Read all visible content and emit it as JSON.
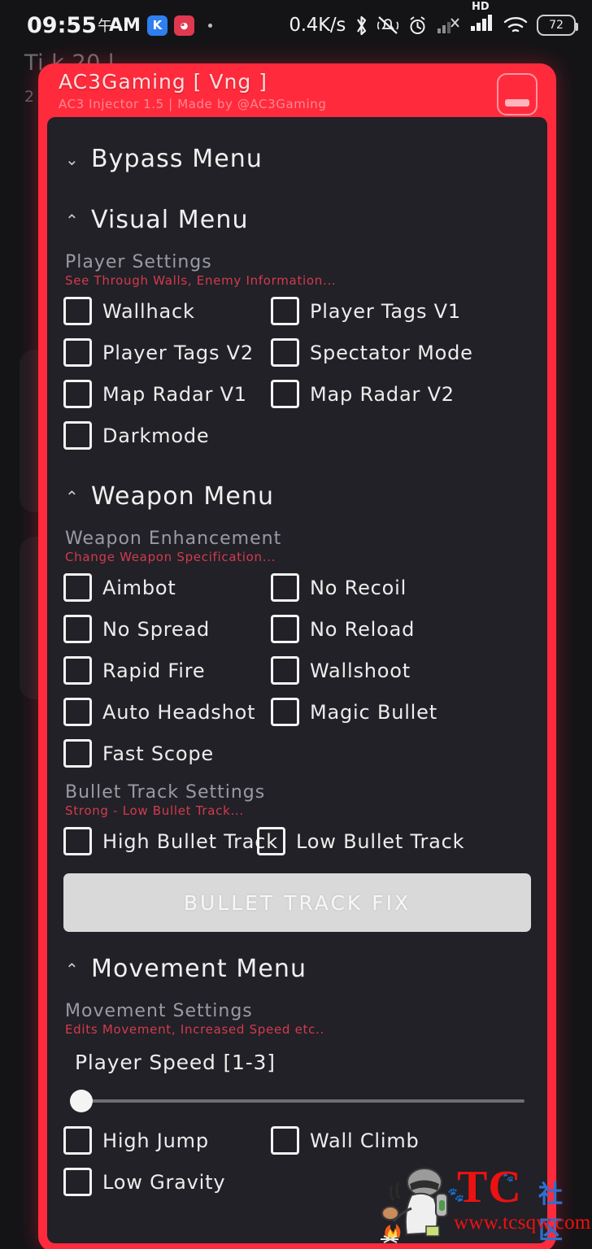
{
  "statusbar": {
    "time": "09:55",
    "ampm": "AM",
    "cjk_marker": "午",
    "app_icons": [
      {
        "name": "kuaishou-app-icon",
        "glyph": "K",
        "color": "#2e7ff0"
      },
      {
        "name": "chat-app-icon",
        "glyph": "●",
        "color": "#e0394f"
      }
    ],
    "network_speed": "0.4K/s",
    "icons": [
      "bluetooth-icon",
      "vibrate-off-icon",
      "alarm-icon",
      "no-sim-signal-icon",
      "hd-label",
      "signal-bars-icon",
      "wifi-icon"
    ],
    "hd_label": "HD",
    "battery_percent": "72"
  },
  "background": {
    "title_fragment": "Ti        k   20 l",
    "line2_fragment": "2"
  },
  "panel": {
    "title": "AC3Gaming [ Vng ]",
    "subtitle": "AC3 Injector 1.5 | Made by @AC3Gaming",
    "minimize_label": "minimize",
    "header_color": "#ff2b3d",
    "body_color": "#212127"
  },
  "sections": [
    {
      "name": "bypass-menu",
      "label": "Bypass Menu",
      "expanded": false,
      "chevron": "⌄"
    },
    {
      "name": "visual-menu",
      "label": "Visual Menu",
      "expanded": true,
      "chevron": "⌃",
      "groups": [
        {
          "heading": "Player Settings",
          "description": "See Through Walls, Enemy Information...",
          "checkboxes": [
            {
              "label": "Wallhack",
              "checked": false
            },
            {
              "label": "Player Tags V1",
              "checked": false
            },
            {
              "label": "Player Tags V2",
              "checked": false
            },
            {
              "label": "Spectator Mode",
              "checked": false
            },
            {
              "label": "Map Radar V1",
              "checked": false
            },
            {
              "label": "Map Radar V2",
              "checked": false
            },
            {
              "label": "Darkmode",
              "checked": false
            }
          ]
        }
      ]
    },
    {
      "name": "weapon-menu",
      "label": "Weapon Menu",
      "expanded": true,
      "chevron": "⌃",
      "groups": [
        {
          "heading": "Weapon Enhancement",
          "description": "Change Weapon Specification...",
          "checkboxes": [
            {
              "label": "Aimbot",
              "checked": false
            },
            {
              "label": "No Recoil",
              "checked": false
            },
            {
              "label": "No Spread",
              "checked": false
            },
            {
              "label": "No Reload",
              "checked": false
            },
            {
              "label": "Rapid Fire",
              "checked": false
            },
            {
              "label": "Wallshoot",
              "checked": false
            },
            {
              "label": "Auto Headshot",
              "checked": false
            },
            {
              "label": "Magic Bullet",
              "checked": false
            },
            {
              "label": "Fast Scope",
              "checked": false
            }
          ]
        },
        {
          "heading": "Bullet Track Settings",
          "description": "Strong - Low Bullet Track...",
          "checkboxes": [
            {
              "label": "High Bullet Track",
              "checked": false
            },
            {
              "label": "Low Bullet Track",
              "checked": false
            }
          ],
          "button": "BULLET TRACK FIX"
        }
      ]
    },
    {
      "name": "movement-menu",
      "label": "Movement Menu",
      "expanded": true,
      "chevron": "⌃",
      "groups": [
        {
          "heading": "Movement Settings",
          "description": "Edits Movement, Increased Speed etc..",
          "slider": {
            "label": "Player Speed [1-3]",
            "min": 1,
            "max": 3,
            "value": 1,
            "percent": 0
          },
          "checkboxes": [
            {
              "label": "High Jump",
              "checked": false
            },
            {
              "label": "Wall Climb",
              "checked": false
            },
            {
              "label": "Low Gravity",
              "checked": false
            }
          ]
        }
      ]
    }
  ],
  "watermark": {
    "brand": "TC",
    "brand_cjk": "社区",
    "url": "www.tcsqw.com"
  }
}
